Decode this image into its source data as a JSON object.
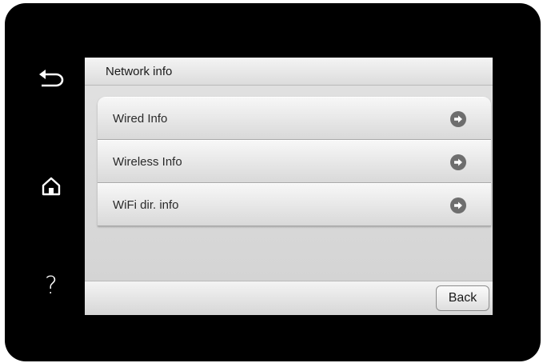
{
  "sidebar": {
    "buttons": [
      {
        "name": "back-icon"
      },
      {
        "name": "home-icon"
      },
      {
        "name": "help-icon",
        "glyph": "?"
      }
    ]
  },
  "header": {
    "title": "Network info"
  },
  "menu": {
    "items": [
      {
        "label": "Wired Info",
        "icon": "arrow-right-circle-icon"
      },
      {
        "label": "Wireless Info",
        "icon": "arrow-right-circle-icon"
      },
      {
        "label": "WiFi dir. info",
        "icon": "arrow-right-circle-icon"
      }
    ]
  },
  "footer": {
    "back_label": "Back"
  },
  "colors": {
    "bezel": "#000000",
    "icon_circle": "#6e6e6e",
    "icon_arrow": "#ffffff"
  }
}
